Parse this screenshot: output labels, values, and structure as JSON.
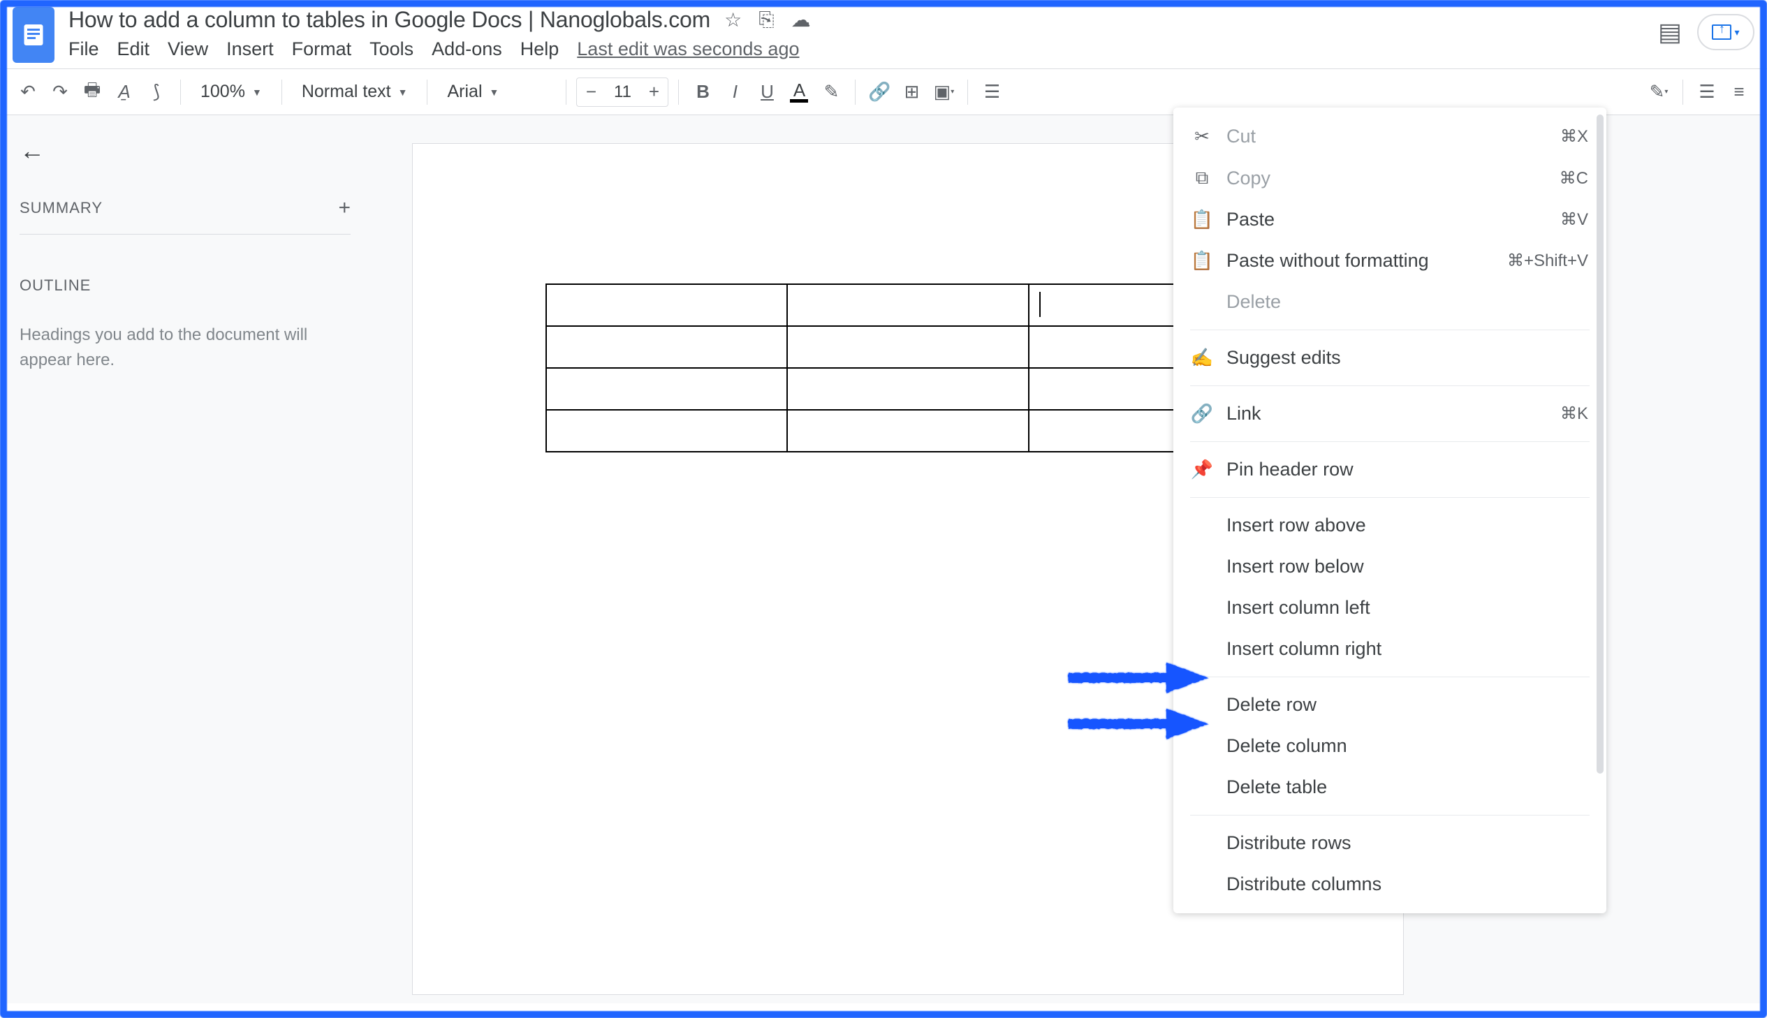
{
  "header": {
    "title": "How to add a column to tables in Google Docs | Nanoglobals.com",
    "last_edit": "Last edit was seconds ago"
  },
  "menus": {
    "file": "File",
    "edit": "Edit",
    "view": "View",
    "insert": "Insert",
    "format": "Format",
    "tools": "Tools",
    "addons": "Add-ons",
    "help": "Help"
  },
  "toolbar": {
    "zoom": "100%",
    "style": "Normal text",
    "font": "Arial",
    "font_size": "11"
  },
  "sidebar": {
    "summary": "SUMMARY",
    "outline": "OUTLINE",
    "outline_hint": "Headings you add to the document will appear here."
  },
  "context_menu": {
    "cut": "Cut",
    "cut_sc": "⌘X",
    "copy": "Copy",
    "copy_sc": "⌘C",
    "paste": "Paste",
    "paste_sc": "⌘V",
    "paste_no_fmt": "Paste without formatting",
    "paste_no_fmt_sc": "⌘+Shift+V",
    "delete": "Delete",
    "suggest": "Suggest edits",
    "link": "Link",
    "link_sc": "⌘K",
    "pin_header": "Pin header row",
    "ins_row_above": "Insert row above",
    "ins_row_below": "Insert row below",
    "ins_col_left": "Insert column left",
    "ins_col_right": "Insert column right",
    "del_row": "Delete row",
    "del_col": "Delete column",
    "del_table": "Delete table",
    "dist_rows": "Distribute rows",
    "dist_cols": "Distribute columns"
  }
}
